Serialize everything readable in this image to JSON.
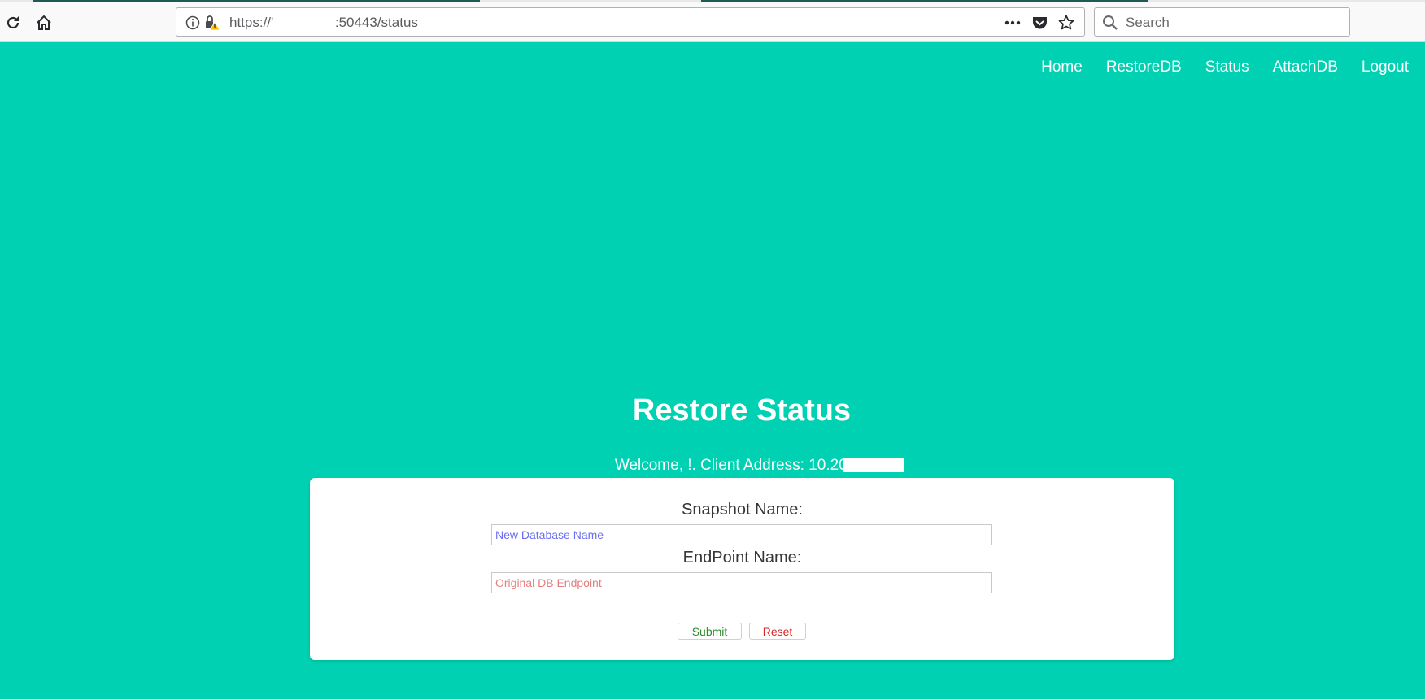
{
  "browser": {
    "url": "https://'                :50443/status",
    "search_placeholder": "Search"
  },
  "nav": {
    "items": [
      "Home",
      "RestoreDB",
      "Status",
      "AttachDB",
      "Logout"
    ]
  },
  "page": {
    "title": "Restore Status",
    "welcome": "Welcome, !. Client Address: 10.200.2"
  },
  "form": {
    "snapshot_label": "Snapshot Name:",
    "snapshot_placeholder": "New Database Name",
    "endpoint_label": "EndPoint Name:",
    "endpoint_placeholder": "Original DB Endpoint",
    "submit_label": "Submit",
    "reset_label": "Reset"
  },
  "colors": {
    "background": "#00d1b2",
    "submit_text": "#2e8b2e",
    "reset_text": "#e02020"
  }
}
